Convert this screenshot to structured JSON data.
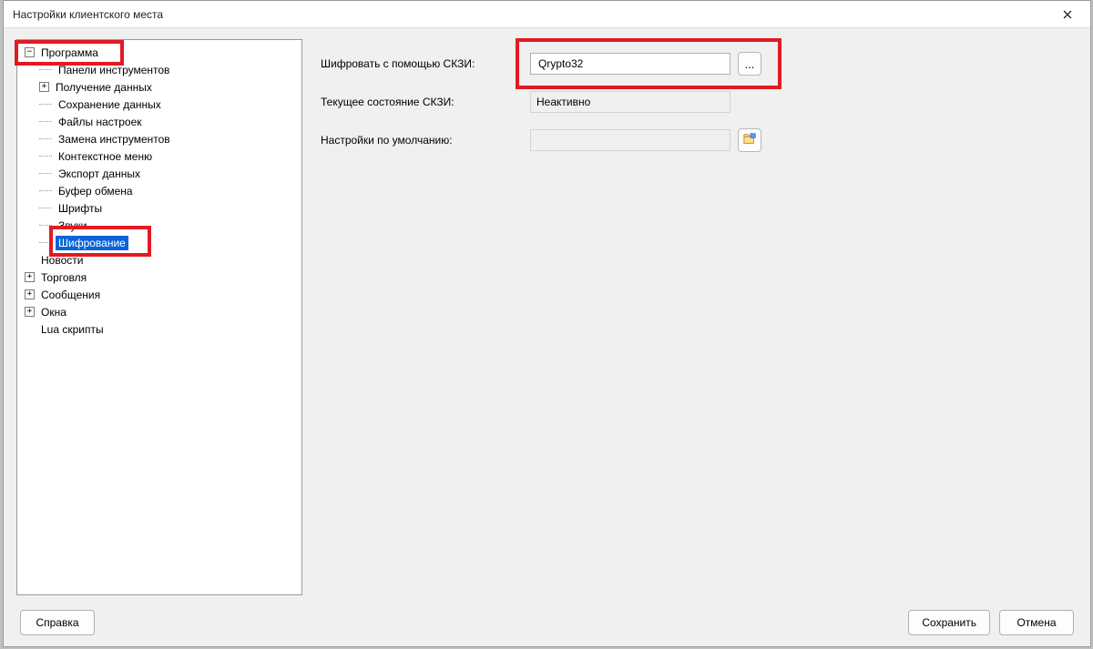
{
  "window": {
    "title": "Настройки клиентского места"
  },
  "tree": {
    "program": "Программа",
    "program_children": {
      "toolbars": "Панели инструментов",
      "data_receive": "Получение данных",
      "data_save": "Сохранение данных",
      "settings_files": "Файлы настроек",
      "instrument_replace": "Замена инструментов",
      "context_menu": "Контекстное меню",
      "data_export": "Экспорт данных",
      "clipboard": "Буфер обмена",
      "fonts": "Шрифты",
      "sounds": "Звуки",
      "encryption": "Шифрование"
    },
    "news": "Новости",
    "trading": "Торговля",
    "messages": "Сообщения",
    "windows": "Окна",
    "lua": "Lua скрипты"
  },
  "form": {
    "encrypt_with_label": "Шифровать с помощью СКЗИ:",
    "encrypt_with_value": "Qrypto32",
    "state_label": "Текущее состояние СКЗИ:",
    "state_value": "Неактивно",
    "defaults_label": "Настройки по умолчанию:",
    "defaults_value": "",
    "browse": "..."
  },
  "footer": {
    "help": "Справка",
    "save": "Сохранить",
    "cancel": "Отмена"
  }
}
